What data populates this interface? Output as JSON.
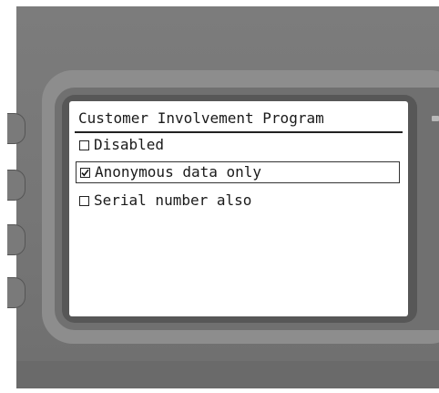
{
  "screen": {
    "title": "Customer Involvement Program",
    "options": [
      {
        "label": "Disabled",
        "checked": false,
        "selected": false
      },
      {
        "label": "Anonymous data only",
        "checked": true,
        "selected": true
      },
      {
        "label": "Serial number also",
        "checked": false,
        "selected": false
      }
    ]
  },
  "icons": {
    "checkbox_checked": "checkbox-checked-icon",
    "checkbox_unchecked": "checkbox-unchecked-icon"
  },
  "colors": {
    "housing": "#757575",
    "bezel": "#8d8d8d",
    "screen_bg": "#ffffff",
    "text": "#1a1a1a"
  }
}
